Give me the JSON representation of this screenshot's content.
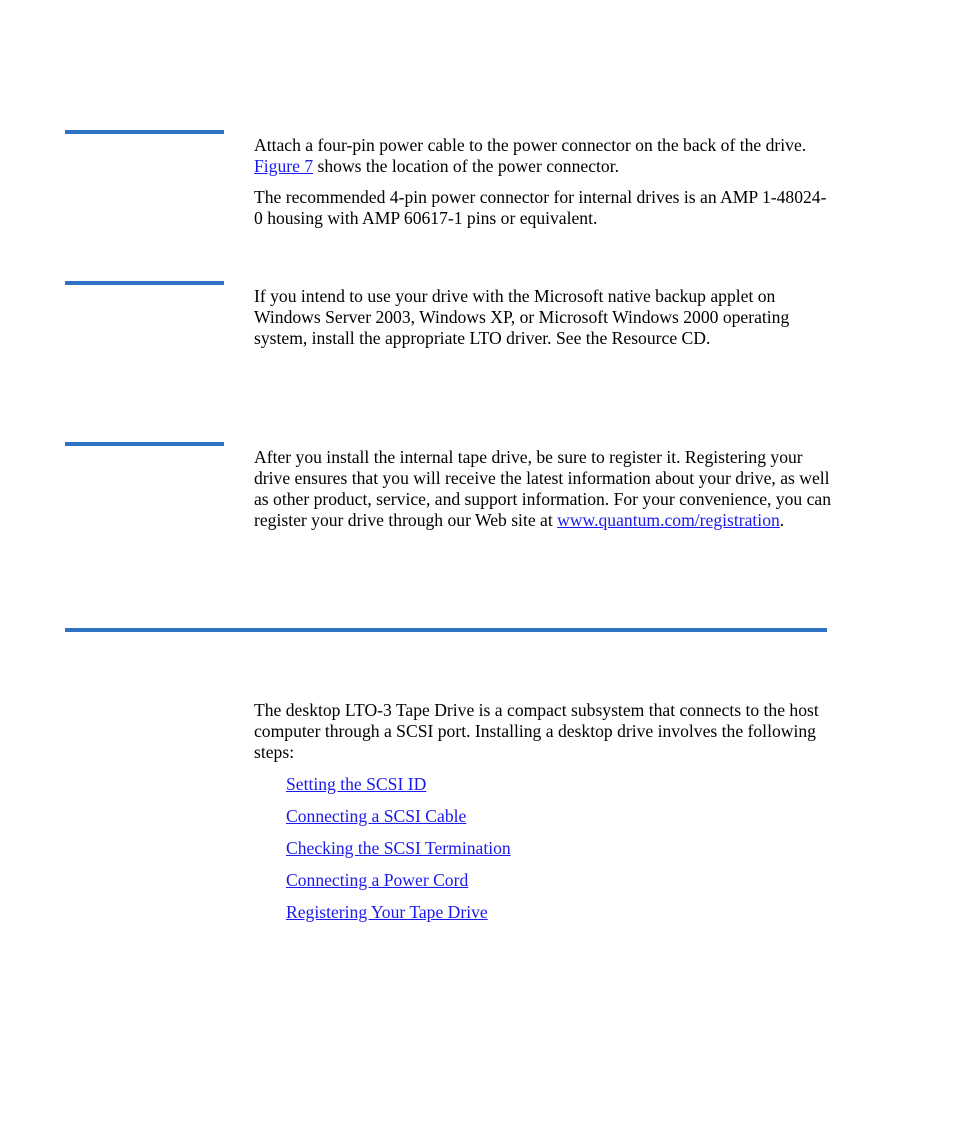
{
  "sections": [
    {
      "paragraphs": [
        {
          "before": "Attach a four-pin power cable to the power connector on the back of the drive. ",
          "link": "Figure 7",
          "after": " shows the location of the power connector."
        },
        {
          "text": "The recommended 4-pin power connector for internal drives is an AMP 1-48024-0 housing with AMP 60617-1 pins or equivalent."
        }
      ]
    },
    {
      "paragraphs": [
        {
          "text": "If you intend to use your drive with the Microsoft native backup applet on Windows Server 2003, Windows XP, or Microsoft Windows 2000 operating system, install the appropriate LTO driver. See the Resource CD."
        }
      ]
    },
    {
      "paragraphs": [
        {
          "before": "After you install the internal tape drive, be sure to register it. Registering your drive ensures that you will receive the latest information about your drive, as well as other product, service, and support information. For your convenience, you can register your drive through our Web site at ",
          "link": "www.quantum.com/registration",
          "after": "."
        }
      ]
    }
  ],
  "desktop": {
    "intro": "The desktop LTO-3 Tape Drive is a compact subsystem that connects to the host computer through a SCSI port. Installing a desktop drive involves the following steps:",
    "steps": [
      "Setting the SCSI ID",
      "Connecting a SCSI Cable",
      "Checking the SCSI Termination",
      "Connecting a Power Cord",
      "Registering Your Tape Drive"
    ]
  },
  "colors": {
    "rule": "#2e72c2",
    "link": "#1a1aee"
  }
}
